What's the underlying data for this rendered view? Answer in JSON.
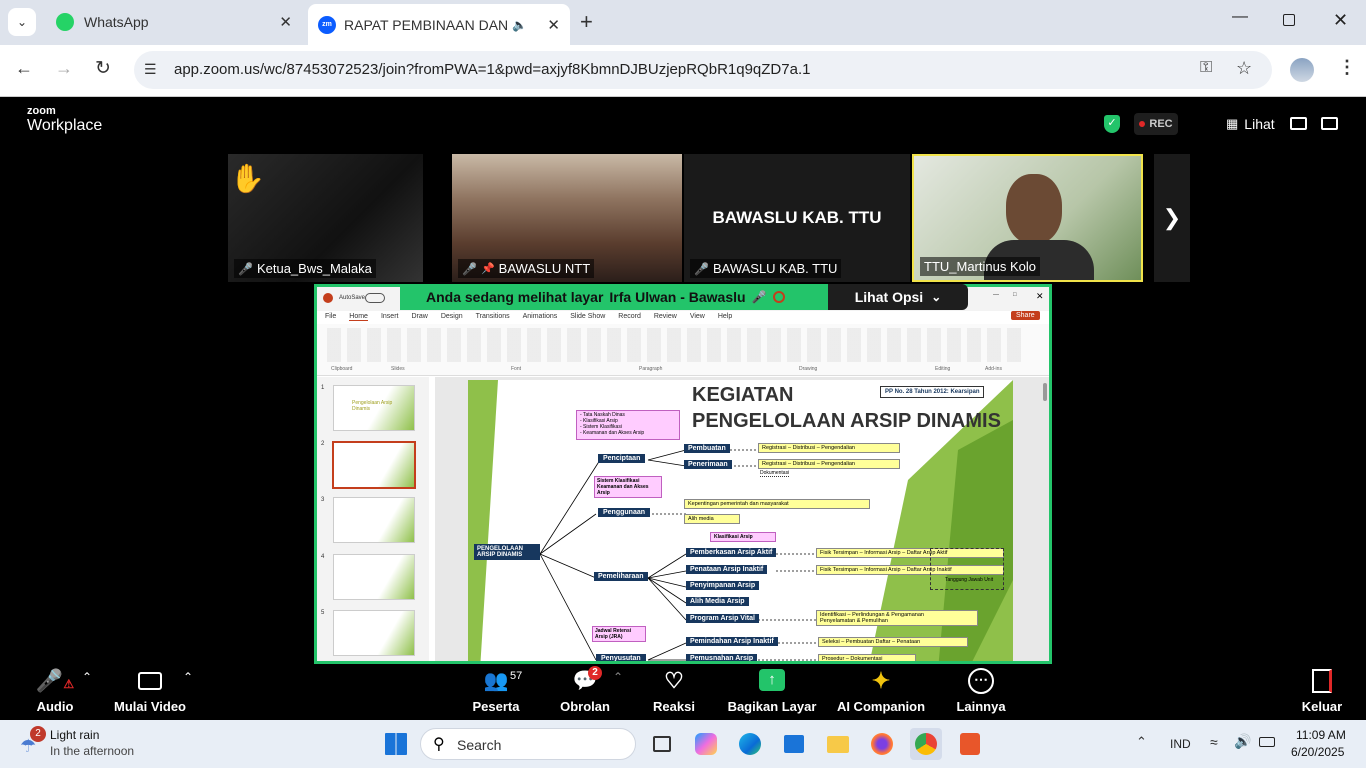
{
  "browser": {
    "tabs": [
      {
        "label": "WhatsApp"
      },
      {
        "label": "RAPAT PEMBINAAN DAN PE"
      }
    ],
    "url": "app.zoom.us/wc/87453072523/join?fromPWA=1&pwd=axjyf8KbmnDJBUzjepRQbR1q9qZD7a.1"
  },
  "zoom_header": {
    "brand_top": "zoom",
    "brand_bottom": "Workplace",
    "rec": "REC",
    "view_label": "Lihat"
  },
  "participants_strip": [
    {
      "name": "Ketua_Bws_Malaka"
    },
    {
      "name": "BAWASLU NTT"
    },
    {
      "name": "BAWASLU KAB. TTU",
      "big_label": "BAWASLU KAB. TTU"
    },
    {
      "name": "TTU_Martinus Kolo"
    }
  ],
  "share_banner": {
    "viewing": "Anda sedang melihat layar",
    "presenter": "Irfa Ulwan - Bawaslu",
    "options": "Lihat Opsi"
  },
  "ppt": {
    "autosave": "AutoSave",
    "share": "Share",
    "menu": [
      "File",
      "Home",
      "Insert",
      "Draw",
      "Design",
      "Transitions",
      "Animations",
      "Slide Show",
      "Record",
      "Review",
      "View",
      "Help"
    ],
    "groups": [
      "Clipboard",
      "Slides",
      "Font",
      "Paragraph",
      "Drawing",
      "Editing",
      "Add-ins"
    ],
    "slide_numbers": [
      "1",
      "2",
      "3",
      "4",
      "5"
    ],
    "slide": {
      "title_line1": "KEGIATAN",
      "title_line2": "PENGELOLAAN ARSIP DINAMIS",
      "reg": "PP No. 28 Tahun 2012: Kearsipan",
      "root": "PENGELOLAAN ARSIP DINAMIS",
      "top_pink": "- Tata Naskah Dinas\n- Klasifikasi Arsip\n- Sistem Klasifikasi\n- Keamanan dan Akses Arsip",
      "penciptaan": "Penciptaan",
      "pembuatan": "Pembuatan",
      "penerimaan": "Penerimaan",
      "yel1": "Registrasi – Distribusi – Pengendalian",
      "yel2": "Registrasi – Distribusi – Pengendalian",
      "dokumentasi": "Dokumentasi",
      "pink2": "Sistem Klasifikasi Keamanan dan Akses Arsip",
      "penggunaan": "Penggunaan",
      "yel3": "Kepentingan pemerintah dan masyarakat",
      "alih_media_small": "Alih media",
      "klasifikasi": "Klasifikasi Arsip",
      "pemeliharaan": "Pemeliharaan",
      "pemberkasan": "Pemberkasan Arsip Aktif",
      "penataan": "Penataan Arsip Inaktif",
      "penyimpanan": "Penyimpanan Arsip",
      "alihmedia": "Alih Media Arsip",
      "vital": "Program Arsip Vital",
      "yel4": "Fisik Tersimpan – Informasi Arsip – Daftar Arsip Aktif",
      "yel5": "Fisik Tersimpan – Informasi Arsip – Daftar Arsip Inaktif",
      "tanggung": "Tanggung Jawab Unit",
      "yel6": "Identifikasi – Perlindungan & Pengamanan\nPenyelamatan & Pemulihan",
      "jra": "Jadwal Retensi Arsip (JRA)",
      "penyusutan": "Penyusutan",
      "pemindahan": "Pemindahan Arsip Inaktif",
      "pemusnahan": "Pemusnahan Arsip",
      "yel7": "Seleksi – Pembuatan Daftar – Penataan",
      "yel8": "Prosedur – Dokumentasi",
      "slide1_title": "Pengelolaan Arsip Dinamis"
    }
  },
  "zoom_toolbar": {
    "audio": "Audio",
    "video": "Mulai Video",
    "peserta": "Peserta",
    "peserta_count": "57",
    "obrolan": "Obrolan",
    "obrolan_badge": "2",
    "reaksi": "Reaksi",
    "bagikan": "Bagikan Layar",
    "ai": "AI Companion",
    "lainnya": "Lainnya",
    "keluar": "Keluar"
  },
  "taskbar": {
    "weather_badge": "2",
    "weather_title": "Light rain",
    "weather_sub": "In the afternoon",
    "search": "Search",
    "lang": "IND",
    "time": "11:09 AM",
    "date": "6/20/2025"
  },
  "colors": {
    "accent_green": "#23c46a",
    "zoom_blue": "#0b5cff",
    "box_navy": "#17375e",
    "box_yellow": "#ffff99",
    "box_pink": "#ffccff"
  }
}
